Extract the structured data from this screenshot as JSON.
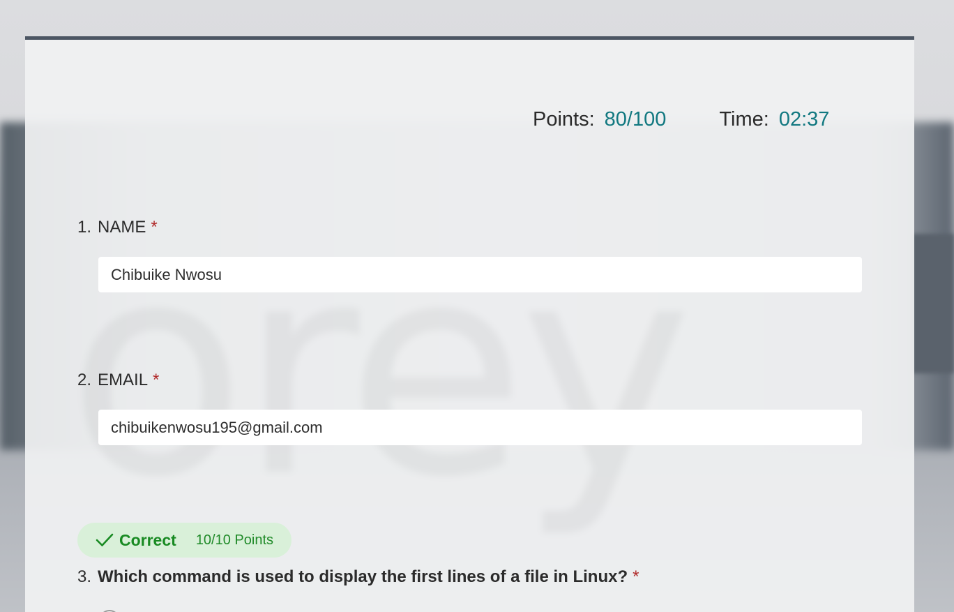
{
  "score": {
    "points_label": "Points:",
    "points_value": "80/100",
    "time_label": "Time:",
    "time_value": "02:37"
  },
  "questions": [
    {
      "number": "1.",
      "title": "NAME",
      "required_mark": "*",
      "answer": "Chibuike Nwosu"
    },
    {
      "number": "2.",
      "title": "EMAIL",
      "required_mark": "*",
      "answer": "chibuikenwosu195@gmail.com"
    },
    {
      "number": "3.",
      "title": "Which command is used to display the first lines of a file in Linux?",
      "required_mark": "*",
      "result_label": "Correct",
      "result_points": "10/10 Points"
    }
  ],
  "colors": {
    "accent": "#117880",
    "correct": "#188a22",
    "required": "#b02a2a",
    "card_border": "#4c5663"
  },
  "icons": {
    "result": "checkmark-icon"
  }
}
